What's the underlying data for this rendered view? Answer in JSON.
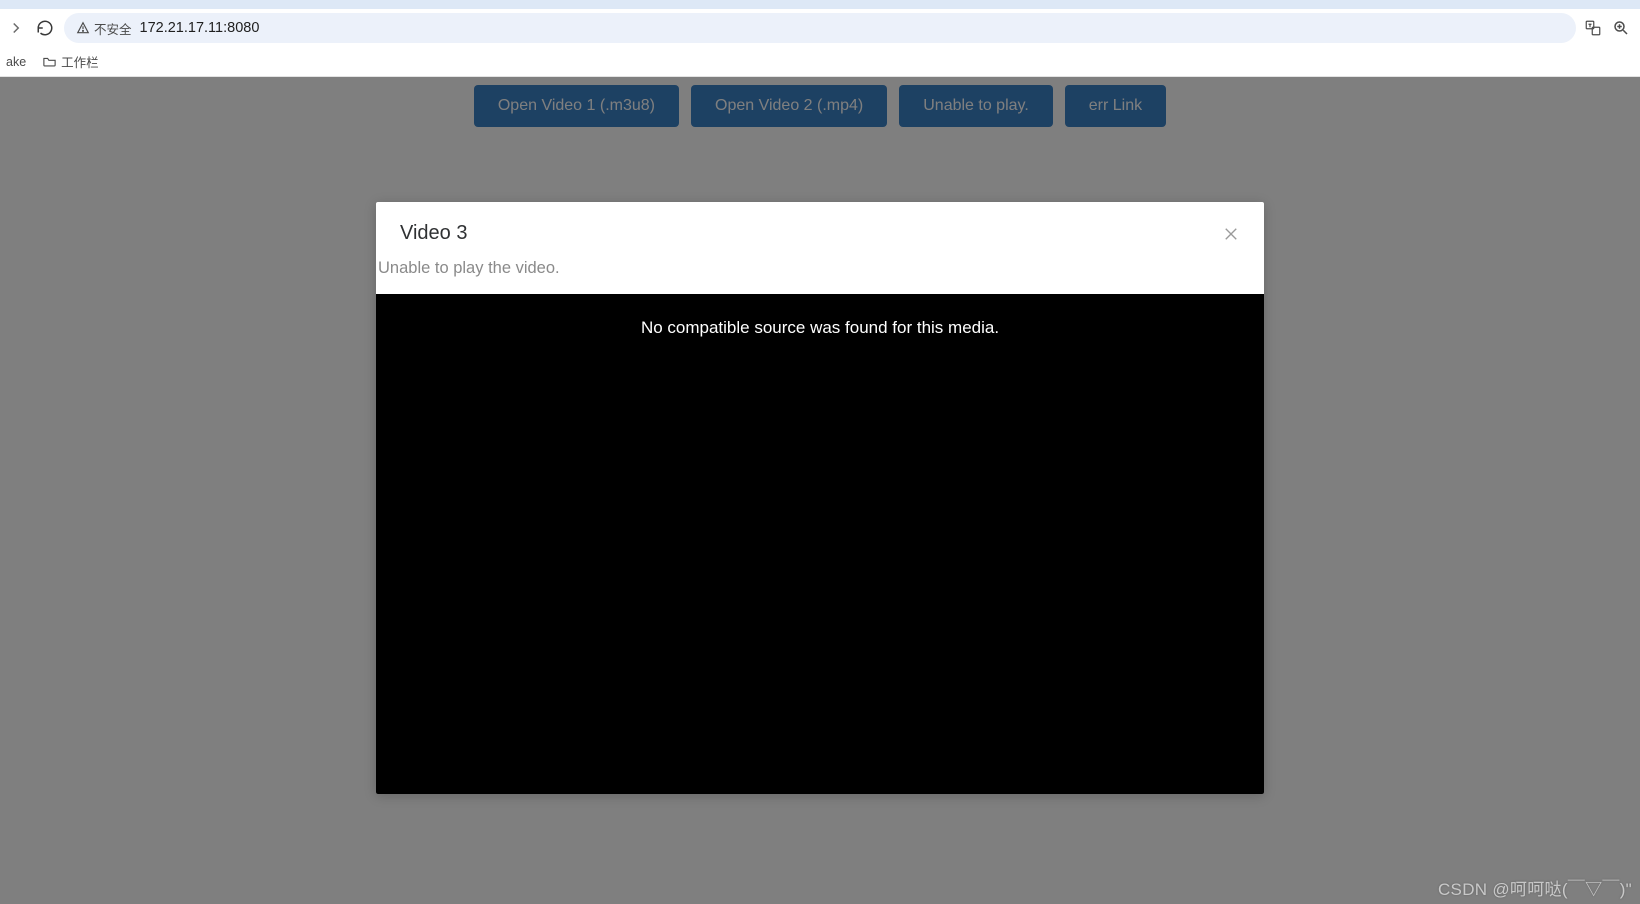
{
  "browser": {
    "insecure_label": "不安全",
    "url": "172.21.17.11:8080",
    "bookmarks": {
      "item1": "ake",
      "item2": "工作栏"
    }
  },
  "buttons": {
    "b1": "Open Video 1 (.m3u8)",
    "b2": "Open Video 2 (.mp4)",
    "b3": "Unable to play.",
    "b4": "err Link"
  },
  "dialog": {
    "title": "Video 3",
    "message": "Unable to play the video.",
    "video_error": "No compatible source was found for this media."
  },
  "watermark": "CSDN @呵呵哒(￣▽￣)\""
}
